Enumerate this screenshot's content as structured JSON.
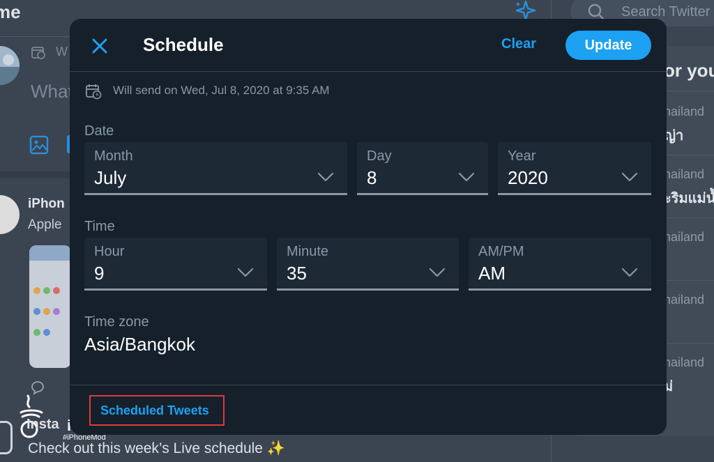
{
  "background": {
    "home_title": "me",
    "search_placeholder": "Search Twitter",
    "compose_placeholder": "What",
    "compose_hint": "W",
    "trends_heading": "or you",
    "trends": [
      {
        "location": "hailand",
        "name": "ญ่า"
      },
      {
        "location": "hailand",
        "name": "ะริมแม่น้ำ"
      },
      {
        "location": "hailand",
        "name": ""
      },
      {
        "location": "hailand",
        "name": ""
      },
      {
        "location": "hailand",
        "name": "ม่"
      }
    ],
    "tweet_author": "iPhon",
    "tweet_text": "Apple",
    "live_text": "Check out this week’s Live schedule ✨",
    "watermark_text": "iMoD",
    "watermark_sub": "#iPhoneMod",
    "watermark_partial": "Insta"
  },
  "modal": {
    "title": "Schedule",
    "clear_label": "Clear",
    "update_label": "Update",
    "will_send": "Will send on Wed, Jul 8, 2020 at 9:35 AM",
    "date_label": "Date",
    "time_label": "Time",
    "date_fields": [
      {
        "label": "Month",
        "value": "July"
      },
      {
        "label": "Day",
        "value": "8"
      },
      {
        "label": "Year",
        "value": "2020"
      }
    ],
    "time_fields": [
      {
        "label": "Hour",
        "value": "9"
      },
      {
        "label": "Minute",
        "value": "35"
      },
      {
        "label": "AM/PM",
        "value": "AM"
      }
    ],
    "timezone_label": "Time zone",
    "timezone_value": "Asia/Bangkok",
    "scheduled_tweets_label": "Scheduled Tweets"
  },
  "colors": {
    "accent": "#1da1f2",
    "modal_bg": "#15202b",
    "field_bg": "#1e2936",
    "highlight_box": "#e0393c"
  }
}
